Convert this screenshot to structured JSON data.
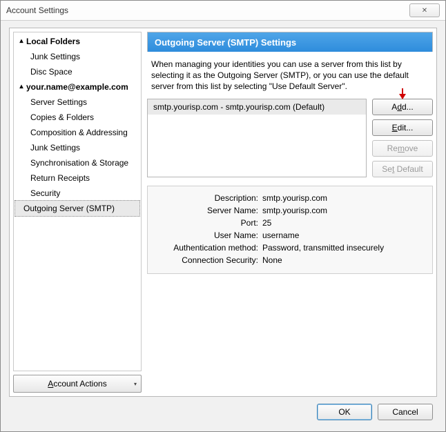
{
  "window": {
    "title": "Account Settings",
    "close_glyph": "✕"
  },
  "sidebar": {
    "groups": [
      {
        "label": "Local Folders",
        "children": [
          {
            "label": "Junk Settings"
          },
          {
            "label": "Disc Space"
          }
        ]
      },
      {
        "label": "your.name@example.com",
        "children": [
          {
            "label": "Server Settings"
          },
          {
            "label": "Copies & Folders"
          },
          {
            "label": "Composition & Addressing"
          },
          {
            "label": "Junk Settings"
          },
          {
            "label": "Synchronisation & Storage"
          },
          {
            "label": "Return Receipts"
          },
          {
            "label": "Security"
          }
        ]
      }
    ],
    "selected": {
      "label": "Outgoing Server (SMTP)"
    },
    "account_actions_label": "Account Actions"
  },
  "main": {
    "header": "Outgoing Server (SMTP) Settings",
    "description": "When managing your identities you can use a server from this list by selecting it as the Outgoing Server (SMTP), or you can use the default server from this list by selecting \"Use Default Server\".",
    "servers": [
      {
        "label": "smtp.yourisp.com - smtp.yourisp.com (Default)"
      }
    ],
    "buttons": {
      "add": "Add...",
      "edit": "Edit...",
      "remove": "Remove",
      "set_default": "Set Default"
    },
    "details": {
      "rows": [
        {
          "label": "Description:",
          "value": "smtp.yourisp.com"
        },
        {
          "label": "Server Name:",
          "value": "smtp.yourisp.com"
        },
        {
          "label": "Port:",
          "value": "25"
        },
        {
          "label": "User Name:",
          "value": "username"
        },
        {
          "label": "Authentication method:",
          "value": "Password, transmitted insecurely"
        },
        {
          "label": "Connection Security:",
          "value": "None"
        }
      ]
    }
  },
  "footer": {
    "ok": "OK",
    "cancel": "Cancel"
  },
  "pointer_glyph": "↓"
}
